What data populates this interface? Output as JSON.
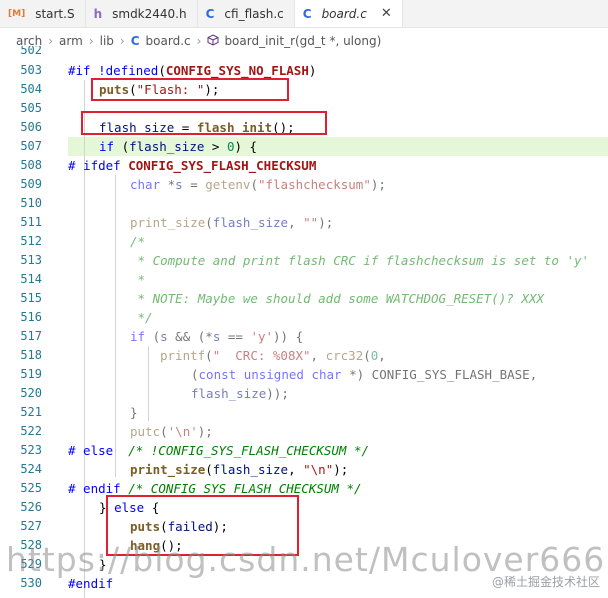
{
  "tabs": [
    {
      "icon": "[M]",
      "label": "start.S",
      "icon_color": "#e37933"
    },
    {
      "icon": "h",
      "label": "smdk2440.h",
      "icon_color": "#8a6cc8"
    },
    {
      "icon": "C",
      "label": "cfi_flash.c",
      "icon_color": "#2f6ae0"
    },
    {
      "icon": "C",
      "label": "board.c",
      "icon_color": "#2f6ae0",
      "close": "✕"
    }
  ],
  "breadcrumb": {
    "parts": [
      "arch",
      "arm",
      "lib"
    ],
    "file_icon": "C",
    "file": "board.c",
    "symbol": "board_init_r(gd_t *, ulong)"
  },
  "gutter": {
    "first_partial": "502",
    "lines": [
      "503",
      "504",
      "505",
      "506",
      "507",
      "508",
      "509",
      "510",
      "511",
      "512",
      "513",
      "514",
      "515",
      "516",
      "517",
      "518",
      "519",
      "520",
      "521",
      "522",
      "523",
      "524",
      "525",
      "526",
      "527",
      "528",
      "529",
      "530"
    ]
  },
  "code": {
    "l503": {
      "a": "#if !",
      "b": "defined",
      "c": "(",
      "d": "CONFIG_SYS_NO_FLASH",
      "e": ")"
    },
    "l504": {
      "a": "puts",
      "b": "(",
      "c": "\"Flash: \"",
      "d": ");"
    },
    "l506": {
      "a": "flash_size",
      "b": " = ",
      "c": "flash_init",
      "d": "();"
    },
    "l507": {
      "a": "if",
      "b": " (",
      "c": "flash_size",
      "d": " > ",
      "e": "0",
      "f": ") {"
    },
    "l508": {
      "a": "# ifdef",
      "b": " CONFIG_SYS_FLASH_CHECKSUM"
    },
    "l509": {
      "a": "char",
      "b": " *",
      "c": "s",
      "d": " = ",
      "e": "getenv",
      "f": "(",
      "g": "\"flashchecksum\"",
      "h": ");"
    },
    "l511": {
      "a": "print_size",
      "b": "(",
      "c": "flash_size",
      "d": ", ",
      "e": "\"\"",
      "f": ");"
    },
    "l512": "/*",
    "l513": " * Compute and print flash CRC if flashchecksum is set to 'y'",
    "l514": " *",
    "l515": " * NOTE: Maybe we should add some WATCHDOG_RESET()? XXX",
    "l516": " */",
    "l517": {
      "a": "if",
      "b": " (",
      "c": "s",
      "d": " && (*",
      "e": "s",
      "f": " == ",
      "g": "'y'",
      "h": ")) {"
    },
    "l518": {
      "a": "printf",
      "b": "(",
      "c": "\"  CRC: %08X\"",
      "d": ", ",
      "e": "crc32",
      "f": "(",
      "g": "0",
      "h": ","
    },
    "l519": {
      "a": "(",
      "b": "const",
      "c": " ",
      "d": "unsigned",
      "e": " ",
      "f": "char",
      "g": " *) CONFIG_SYS_FLASH_BASE,"
    },
    "l520": {
      "a": "flash_size",
      "b": "));"
    },
    "l521": "}",
    "l522": {
      "a": "putc",
      "b": "(",
      "c": "'\\n'",
      "d": ");"
    },
    "l523": {
      "a": "# else",
      "b": "  /* !CONFIG_SYS_FLASH_CHECKSUM */"
    },
    "l524": {
      "a": "print_size",
      "b": "(",
      "c": "flash_size",
      "d": ", ",
      "e": "\"\\n\"",
      "f": ");"
    },
    "l525": {
      "a": "# endif",
      "b": " /* CONFIG_SYS_FLASH_CHECKSUM */"
    },
    "l526": {
      "a": "} ",
      "b": "else",
      "c": " {"
    },
    "l527": {
      "a": "puts",
      "b": "(",
      "c": "failed",
      "d": ");"
    },
    "l528": {
      "a": "hang",
      "b": "();"
    },
    "l529": "}",
    "l530": "#endif"
  },
  "colors": {
    "annotation_box": "#e02030",
    "current_line": "#e4f7d6",
    "line_number": "#237893"
  },
  "watermark": "https://blog.csdn.net/Mculover666",
  "credit": "@稀土掘金技术社区"
}
